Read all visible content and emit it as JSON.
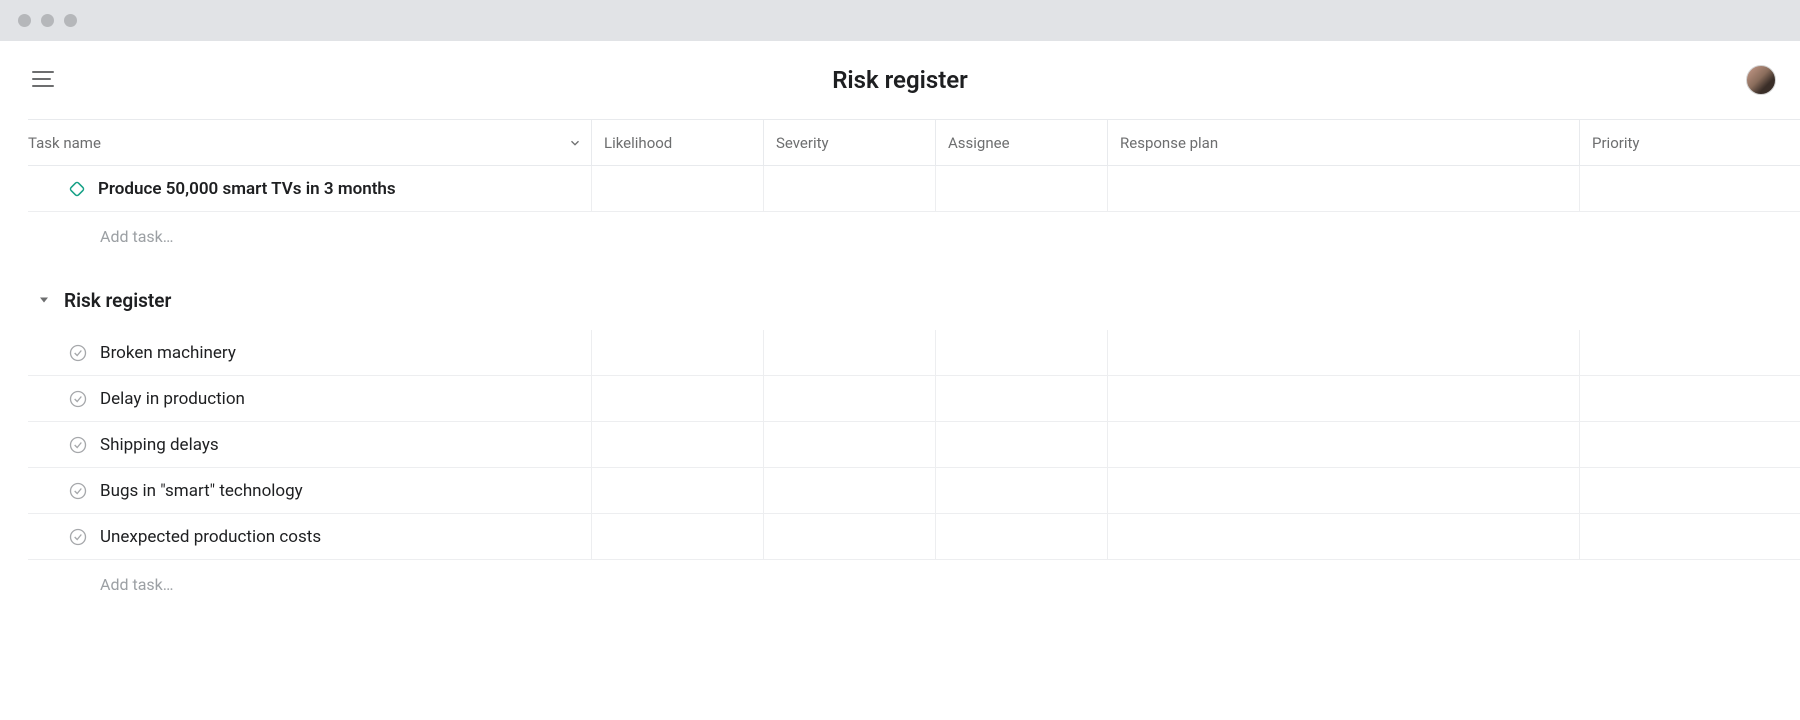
{
  "header": {
    "title": "Risk register"
  },
  "columns": {
    "task_name": "Task name",
    "likelihood": "Likelihood",
    "severity": "Severity",
    "assignee": "Assignee",
    "response_plan": "Response plan",
    "priority": "Priority"
  },
  "milestone": {
    "name": "Produce 50,000 smart TVs in 3 months"
  },
  "add_task_label": "Add task…",
  "section": {
    "title": "Risk register",
    "tasks": [
      {
        "name": "Broken machinery"
      },
      {
        "name": "Delay in production"
      },
      {
        "name": "Shipping delays"
      },
      {
        "name": "Bugs in \"smart\" technology"
      },
      {
        "name": "Unexpected production costs"
      }
    ]
  }
}
